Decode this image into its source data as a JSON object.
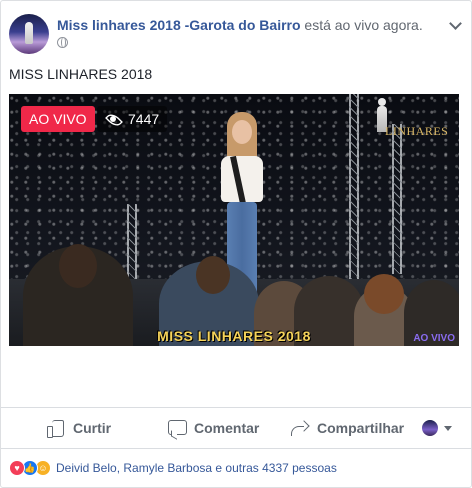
{
  "post": {
    "page_name": "Miss linhares 2018 -Garota do Bairro",
    "status": "está ao vivo agora.",
    "visibility_icon": "globe-icon",
    "text": "MISS LINHARES 2018"
  },
  "video": {
    "live_label": "AO VIVO",
    "viewer_count": "7447",
    "logo_text": "LINHARES",
    "caption": "MISS LINHARES 2018",
    "watermark": "AO VIVO"
  },
  "actions": {
    "like_label": "Curtir",
    "comment_label": "Comentar",
    "share_label": "Compartilhar"
  },
  "reactions": {
    "icons": [
      "love-icon",
      "like-icon",
      "haha-icon"
    ],
    "summary": "Deivid Belo, Ramyle Barbosa e outras 4337 pessoas"
  },
  "colors": {
    "link": "#365899",
    "live_red": "#f02849",
    "caption_yellow": "#f5d35a"
  }
}
